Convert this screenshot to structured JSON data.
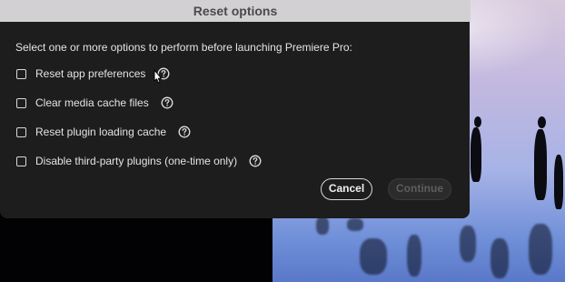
{
  "dialog": {
    "title": "Reset options",
    "prompt": "Select one or more options to perform before launching Premiere Pro:",
    "options": [
      {
        "label": "Reset app preferences",
        "checked": false,
        "icon": "help-icon"
      },
      {
        "label": "Clear media cache files",
        "checked": false,
        "icon": "help-icon"
      },
      {
        "label": "Reset plugin loading cache",
        "checked": false,
        "icon": "help-icon"
      },
      {
        "label": "Disable third-party plugins (one-time only)",
        "checked": false,
        "icon": "help-icon"
      }
    ],
    "buttons": {
      "cancel_label": "Cancel",
      "continue_label": "Continue",
      "continue_enabled": false
    }
  },
  "colors": {
    "dialog_bg": "#1d1d1d",
    "title_bg": "#d2d0d3",
    "text": "#e4e4e4",
    "disabled_text": "#5d5d5d"
  }
}
